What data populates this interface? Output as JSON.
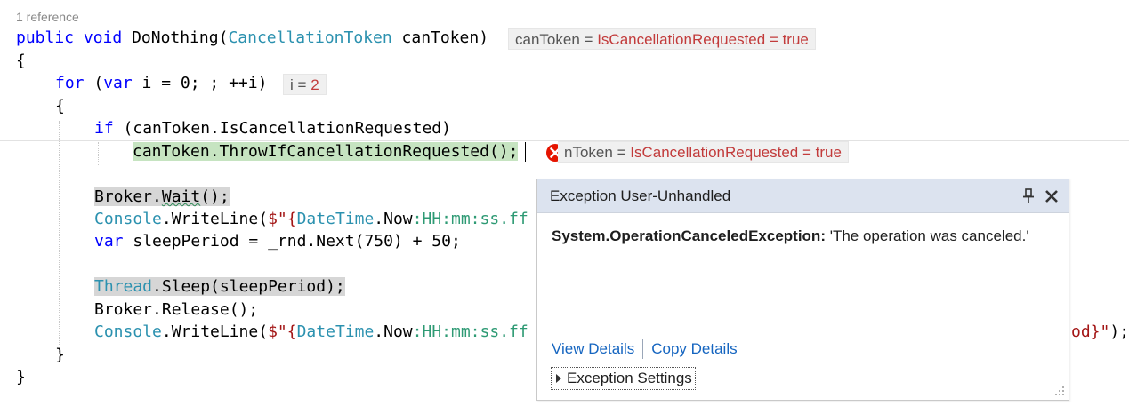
{
  "codelens": "1 reference",
  "code": {
    "signature": {
      "kw1": "public",
      "kw2": "void",
      "name": "DoNothing(",
      "type": "CancellationToken",
      "param": " canToken)"
    },
    "open_brace_1": "{",
    "for_line": {
      "kw1": "for",
      "rest1": " (",
      "kw2": "var",
      "rest2": " i = 0; ; ++i)"
    },
    "open_brace_2": "{",
    "if_line": {
      "kw": "if",
      "rest": " (canToken.IsCancellationRequested)"
    },
    "throw_line": "canToken.ThrowIfCancellationRequested();",
    "wait_line": {
      "a": "Broker.",
      "b": "Wait",
      "c": "();"
    },
    "console1": {
      "type": "Console",
      "a": ".WriteLine(",
      "s1": "$\"{",
      "type2": "DateTime",
      "a2": ".Now",
      "fmt": ":HH:mm:ss.ff"
    },
    "sleep_decl": {
      "kw": "var",
      "rest": " sleepPeriod = _rnd.Next(750) + 50;"
    },
    "thread_line": {
      "type": "Thread",
      "rest": ".Sleep(sleepPeriod);"
    },
    "release_line": "Broker.Release();",
    "console2": {
      "type": "Console",
      "a": ".WriteLine(",
      "s1": "$\"{",
      "type2": "DateTime",
      "a2": ".Now",
      "fmt": ":HH:mm:ss.ff",
      "tail_str": "od}\"",
      "tail": ");"
    },
    "close_brace_2": "}",
    "close_brace_1": "}"
  },
  "datatips": [
    {
      "name": "canToken",
      "eq": "=",
      "value": "IsCancellationRequested = true"
    },
    {
      "name": "i",
      "eq": "=",
      "value": "2"
    },
    {
      "name": "nToken",
      "eq": "=",
      "value": "IsCancellationRequested = true"
    }
  ],
  "exception_popup": {
    "title": "Exception User-Unhandled",
    "exception_type": "System.OperationCanceledException:",
    "message": "'The operation was canceled.'",
    "view_details": "View Details",
    "copy_details": "Copy Details",
    "exception_settings": "Exception Settings"
  },
  "icons": [
    "pin-icon",
    "close-icon",
    "error-icon",
    "expand-triangle-icon",
    "resize-grip-icon"
  ],
  "colors": {
    "keyword": "#0000ff",
    "type": "#2b91af",
    "string": "#a31515",
    "datatip_value": "#c23b3b",
    "link": "#1565c0",
    "popup_header": "#dce3ef",
    "current_statement": "#c6e4c1"
  }
}
